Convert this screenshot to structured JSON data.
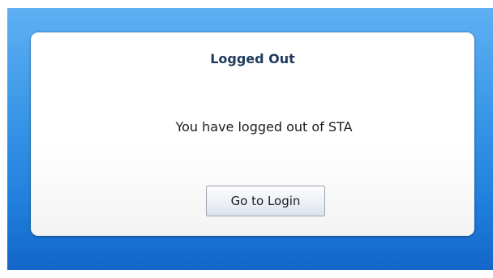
{
  "dialog": {
    "title": "Logged Out",
    "message": "You have logged out of STA",
    "login_button_label": "Go to Login"
  },
  "colors": {
    "background_top": "#5fb0f3",
    "background_bottom": "#1366c8",
    "title_text": "#1f3a5c"
  }
}
